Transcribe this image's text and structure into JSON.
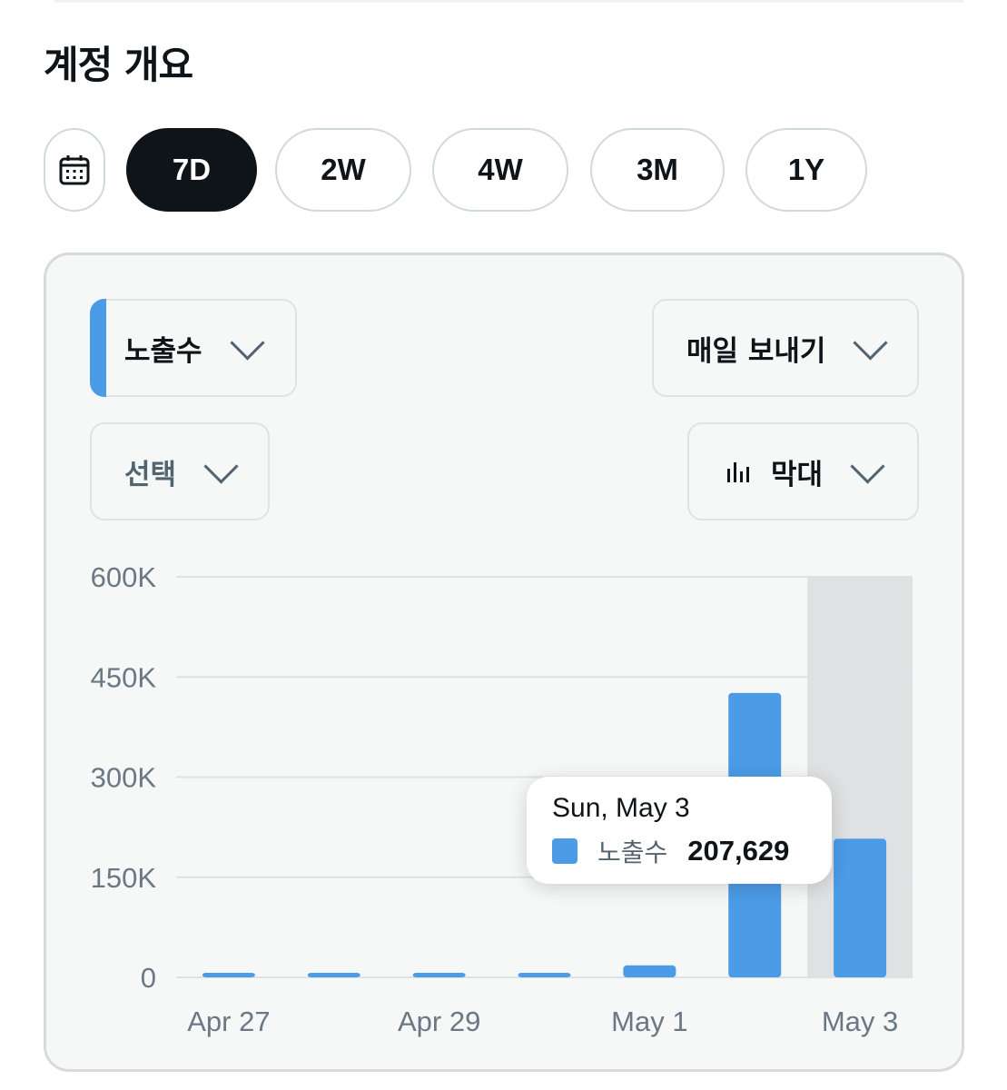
{
  "page": {
    "title": "계정 개요"
  },
  "range_bar": {
    "calendar_icon": "calendar-icon",
    "options": [
      "7D",
      "2W",
      "4W",
      "3M",
      "1Y"
    ],
    "selected": "7D"
  },
  "controls": {
    "metric": "노출수",
    "export": "매일 보내기",
    "select": "선택",
    "chart_type": "막대",
    "chart_type_icon": "bar-chart-icon"
  },
  "tooltip": {
    "date": "Sun, May 3",
    "series": "노출수",
    "value": "207,629"
  },
  "colors": {
    "bar": "#4b9be7",
    "highlight": "#dfe1e3",
    "accent": "#4b9be7"
  },
  "chart_data": {
    "type": "bar",
    "categories": [
      "Apr 27",
      "Apr 28",
      "Apr 29",
      "Apr 30",
      "May 1",
      "May 2",
      "May 3"
    ],
    "x_tick_labels": [
      "Apr 27",
      "Apr 29",
      "May 1",
      "May 3"
    ],
    "series": [
      {
        "name": "노출수",
        "values": [
          1500,
          1500,
          1500,
          5000,
          18000,
          426000,
          207629
        ]
      }
    ],
    "ylim": [
      0,
      600000
    ],
    "y_ticks": [
      0,
      150000,
      300000,
      450000,
      600000
    ],
    "y_tick_labels": [
      "0",
      "150K",
      "300K",
      "450K",
      "600K"
    ],
    "highlighted_category": "May 3",
    "grid": true
  }
}
